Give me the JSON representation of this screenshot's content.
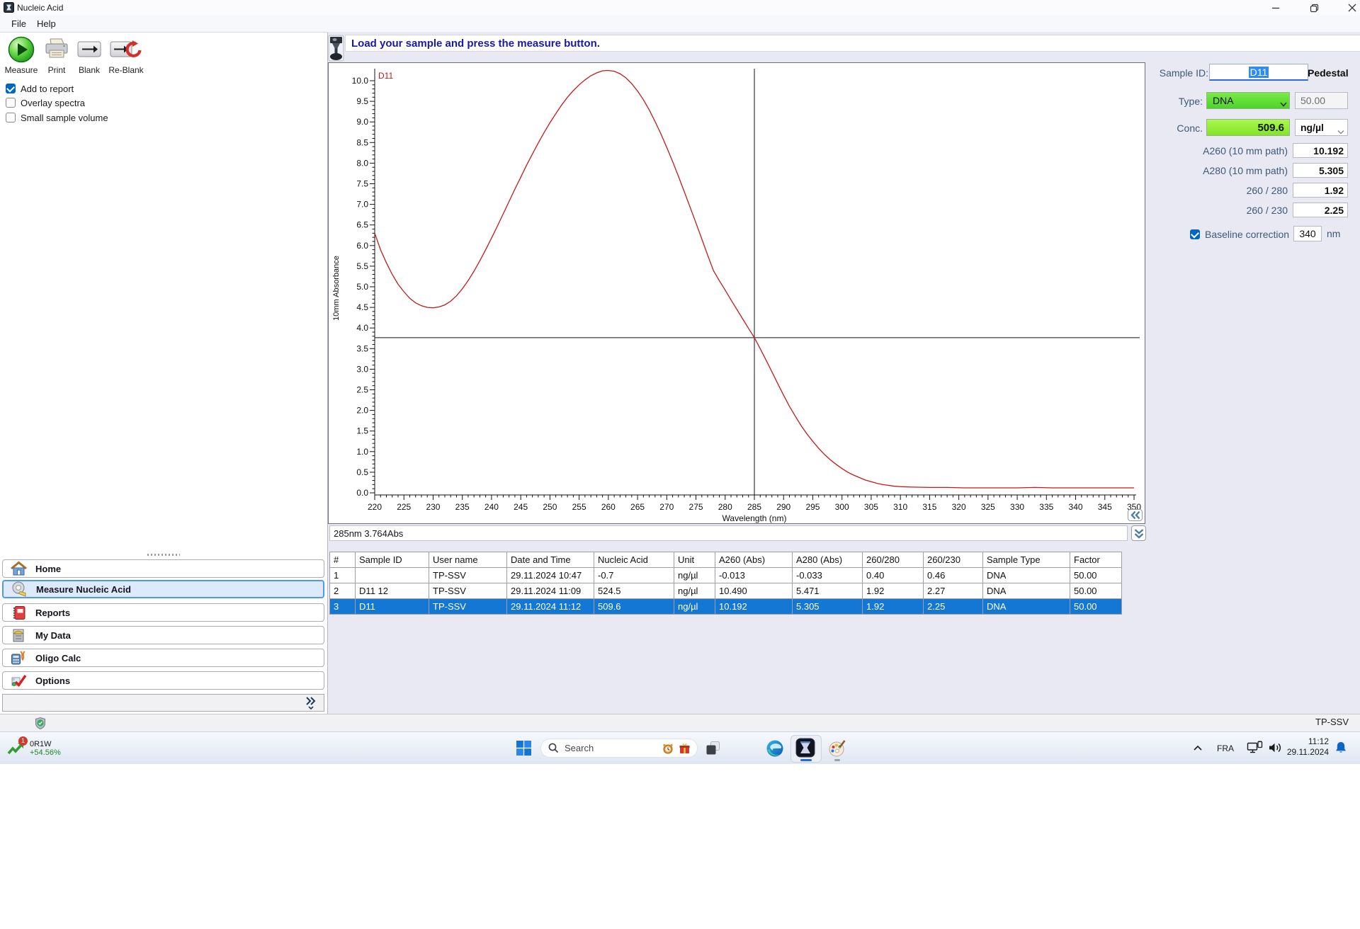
{
  "colors": {
    "accent_green": "#61e234",
    "conc_green": "#8df02c",
    "selection_blue": "#1477d4",
    "curve_red": "#c41a1a"
  },
  "window": {
    "title": "Nucleic Acid",
    "menu": [
      "File",
      "Help"
    ]
  },
  "toolbar": {
    "measure": "Measure",
    "print": "Print",
    "blank": "Blank",
    "reblank": "Re-Blank"
  },
  "report_options": [
    {
      "label": "Add to report",
      "checked": true
    },
    {
      "label": "Overlay spectra",
      "checked": false
    },
    {
      "label": "Small sample volume",
      "checked": false
    }
  ],
  "message": "Load your sample and press the measure button.",
  "chart_data": {
    "type": "line",
    "xlabel": "Wavelength (nm)",
    "ylabel": "10mm Absorbance",
    "xlim": [
      220,
      350
    ],
    "ylim": [
      0,
      10
    ],
    "x_tick_major": 5,
    "x_tick_minor": 1,
    "y_tick_major": 0.5,
    "y_tick_minor": 0.1,
    "curve_label": "D11",
    "crosshair": {
      "x": 285,
      "y": 3.764
    },
    "series": [
      {
        "name": "D11",
        "color": "#c41a1a",
        "points": [
          [
            220,
            6.3
          ],
          [
            221,
            5.9
          ],
          [
            222,
            5.58
          ],
          [
            223,
            5.3
          ],
          [
            224,
            5.06
          ],
          [
            225,
            4.88
          ],
          [
            226,
            4.72
          ],
          [
            227,
            4.61
          ],
          [
            228,
            4.54
          ],
          [
            229,
            4.5
          ],
          [
            230,
            4.49
          ],
          [
            231,
            4.51
          ],
          [
            232,
            4.56
          ],
          [
            233,
            4.65
          ],
          [
            234,
            4.78
          ],
          [
            235,
            4.95
          ],
          [
            236,
            5.15
          ],
          [
            237,
            5.38
          ],
          [
            238,
            5.63
          ],
          [
            239,
            5.9
          ],
          [
            240,
            6.18
          ],
          [
            241,
            6.47
          ],
          [
            242,
            6.77
          ],
          [
            243,
            7.07
          ],
          [
            244,
            7.37
          ],
          [
            245,
            7.66
          ],
          [
            246,
            7.95
          ],
          [
            247,
            8.22
          ],
          [
            248,
            8.49
          ],
          [
            249,
            8.74
          ],
          [
            250,
            8.98
          ],
          [
            251,
            9.2
          ],
          [
            252,
            9.41
          ],
          [
            253,
            9.6
          ],
          [
            254,
            9.76
          ],
          [
            255,
            9.9
          ],
          [
            256,
            10.02
          ],
          [
            257,
            10.12
          ],
          [
            258,
            10.19
          ],
          [
            259,
            10.24
          ],
          [
            260,
            10.25
          ],
          [
            261,
            10.23
          ],
          [
            262,
            10.17
          ],
          [
            263,
            10.07
          ],
          [
            264,
            9.93
          ],
          [
            265,
            9.75
          ],
          [
            266,
            9.54
          ],
          [
            267,
            9.29
          ],
          [
            268,
            9.01
          ],
          [
            269,
            8.71
          ],
          [
            270,
            8.38
          ],
          [
            271,
            8.04
          ],
          [
            272,
            7.68
          ],
          [
            273,
            7.31
          ],
          [
            274,
            6.93
          ],
          [
            275,
            6.55
          ],
          [
            276,
            6.16
          ],
          [
            277,
            5.77
          ],
          [
            278,
            5.39
          ],
          [
            279,
            5.15
          ],
          [
            280,
            4.92
          ],
          [
            281,
            4.68
          ],
          [
            282,
            4.45
          ],
          [
            283,
            4.22
          ],
          [
            284,
            3.99
          ],
          [
            285,
            3.764
          ],
          [
            286,
            3.5
          ],
          [
            287,
            3.22
          ],
          [
            288,
            2.94
          ],
          [
            289,
            2.65
          ],
          [
            290,
            2.37
          ],
          [
            291,
            2.1
          ],
          [
            292,
            1.86
          ],
          [
            293,
            1.63
          ],
          [
            294,
            1.43
          ],
          [
            295,
            1.25
          ],
          [
            296,
            1.08
          ],
          [
            297,
            0.93
          ],
          [
            298,
            0.8
          ],
          [
            299,
            0.69
          ],
          [
            300,
            0.59
          ],
          [
            301,
            0.5
          ],
          [
            302,
            0.43
          ],
          [
            303,
            0.37
          ],
          [
            304,
            0.31
          ],
          [
            305,
            0.27
          ],
          [
            306,
            0.23
          ],
          [
            307,
            0.2
          ],
          [
            308,
            0.18
          ],
          [
            309,
            0.16
          ],
          [
            310,
            0.15
          ],
          [
            312,
            0.14
          ],
          [
            315,
            0.13
          ],
          [
            318,
            0.13
          ],
          [
            321,
            0.12
          ],
          [
            324,
            0.12
          ],
          [
            327,
            0.12
          ],
          [
            330,
            0.12
          ],
          [
            333,
            0.13
          ],
          [
            336,
            0.12
          ],
          [
            340,
            0.12
          ],
          [
            344,
            0.12
          ],
          [
            348,
            0.12
          ],
          [
            350,
            0.12
          ]
        ]
      }
    ]
  },
  "readout": "285nm 3.764Abs",
  "sample_panel": {
    "sample_id_label": "Sample ID:",
    "sample_id": "D11",
    "mode": "Pedestal",
    "type_label": "Type:",
    "type": "DNA",
    "type_factor": "50.00",
    "conc_label": "Conc.",
    "conc": "509.6",
    "conc_unit": "ng/µl",
    "fields": [
      {
        "label": "A260 (10 mm path)",
        "value": "10.192"
      },
      {
        "label": "A280 (10 mm path)",
        "value": "5.305"
      },
      {
        "label": "260 / 280",
        "value": "1.92"
      },
      {
        "label": "260 / 230",
        "value": "2.25"
      }
    ],
    "baseline": {
      "label": "Baseline correction",
      "checked": true,
      "value": "340",
      "unit": "nm"
    }
  },
  "results_table": {
    "columns": [
      "#",
      "Sample ID",
      "User name",
      "Date and Time",
      "Nucleic Acid",
      "Unit",
      "A260 (Abs)",
      "A280 (Abs)",
      "260/280",
      "260/230",
      "Sample Type",
      "Factor"
    ],
    "rows": [
      [
        "1",
        "",
        "TP-SSV",
        "29.11.2024 10:47",
        "-0.7",
        "ng/µl",
        "-0.013",
        "-0.033",
        "0.40",
        "0.46",
        "DNA",
        "50.00"
      ],
      [
        "2",
        "D11 12",
        "TP-SSV",
        "29.11.2024 11:09",
        "524.5",
        "ng/µl",
        "10.490",
        "5.471",
        "1.92",
        "2.27",
        "DNA",
        "50.00"
      ],
      [
        "3",
        "D11",
        "TP-SSV",
        "29.11.2024 11:12",
        "509.6",
        "ng/µl",
        "10.192",
        "5.305",
        "1.92",
        "2.25",
        "DNA",
        "50.00"
      ]
    ],
    "selected_row": 2
  },
  "sidebar": {
    "items": [
      {
        "label": "Home",
        "icon": "home-icon",
        "selected": false
      },
      {
        "label": "Measure Nucleic Acid",
        "icon": "measure-tape-icon",
        "selected": true
      },
      {
        "label": "Reports",
        "icon": "reports-icon",
        "selected": false
      },
      {
        "label": "My Data",
        "icon": "my-data-icon",
        "selected": false
      },
      {
        "label": "Oligo Calc",
        "icon": "oligo-calc-icon",
        "selected": false
      },
      {
        "label": "Options",
        "icon": "options-icon",
        "selected": false
      }
    ]
  },
  "statusbar": {
    "user": "TP-SSV"
  },
  "taskbar": {
    "widget": {
      "badge": "1",
      "ticker": "0R1W",
      "change": "+54.56%"
    },
    "search_placeholder": "Search",
    "tray": {
      "language": "FRA",
      "time": "11:12",
      "date": "29.11.2024"
    }
  }
}
